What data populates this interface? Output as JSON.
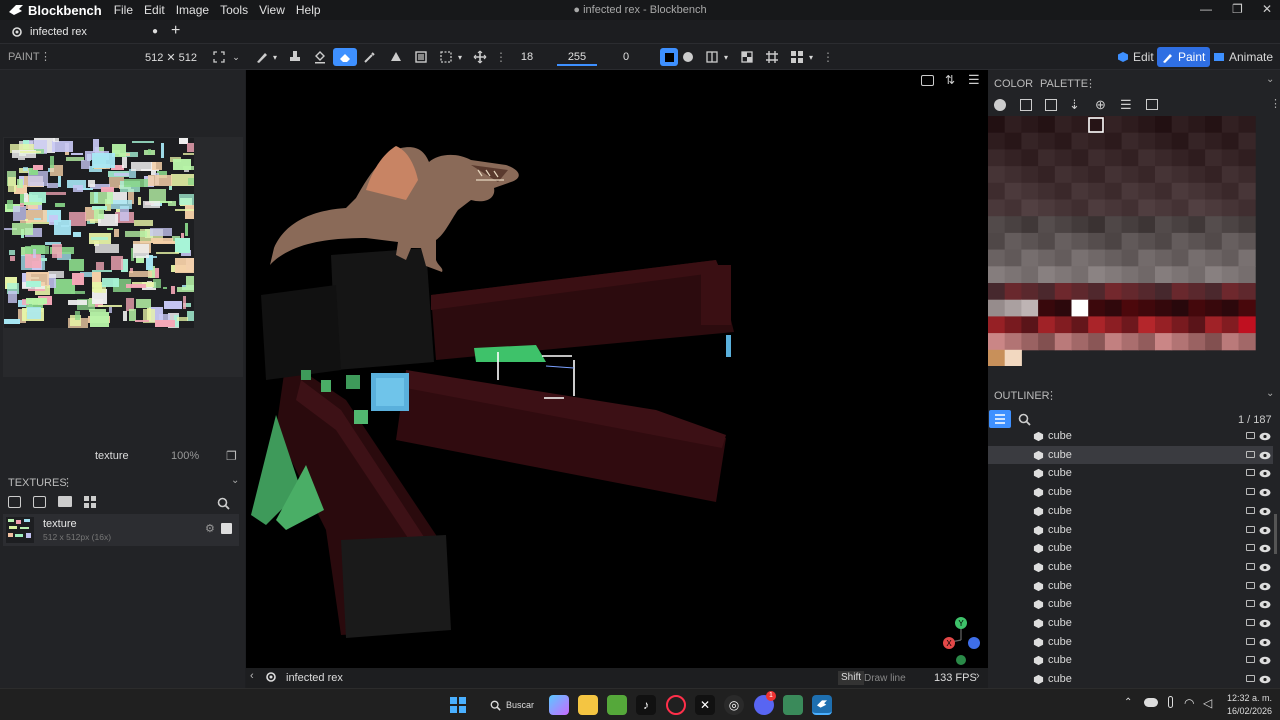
{
  "app": {
    "name": "Blockbench",
    "window_title": "● infected rex - Blockbench",
    "menu": [
      "File",
      "Edit",
      "Image",
      "Tools",
      "View",
      "Help"
    ]
  },
  "tab": {
    "label": "infected rex",
    "unsaved_dot": "●",
    "add": "+"
  },
  "toolbar": {
    "mode_label": "PAINT",
    "mode_menu": "⋮",
    "resolution": "512 ✕ 512",
    "brush_size": "18",
    "opacity": "255",
    "softness": "0"
  },
  "modes": {
    "edit": "Edit",
    "paint": "Paint",
    "animate": "Animate"
  },
  "uv": {
    "texture_name": "texture",
    "zoom": "100%"
  },
  "textures": {
    "header": "TEXTURES",
    "menu": "⋮",
    "items": [
      {
        "name": "texture",
        "meta": "512 x 512px (16x)"
      }
    ]
  },
  "color_panel": {
    "tab_color": "COLOR",
    "tab_palette": "PALETTE",
    "menu": "⋮"
  },
  "outliner": {
    "header": "OUTLINER",
    "menu": "⋮",
    "count": "1 / 187",
    "rows": [
      "cube",
      "cube",
      "cube",
      "cube",
      "cube",
      "cube",
      "cube",
      "cube",
      "cube",
      "cube",
      "cube",
      "cube",
      "cube",
      "cube"
    ]
  },
  "viewport": {
    "model_name": "infected rex",
    "shift_key": "Shift",
    "hint": "Draw line",
    "fps": "133 FPS",
    "axis_y": "Y",
    "axis_x": "X"
  },
  "taskbar": {
    "search": "Buscar",
    "time": "12:32 a. m.",
    "date": "16/02/2026",
    "discord_badge": "1"
  },
  "colors": {
    "accent": "#3e90ff",
    "paint_mode_bg": "#2f6fe3",
    "viewport_bg": "#000000",
    "panel_bg": "#222326"
  }
}
